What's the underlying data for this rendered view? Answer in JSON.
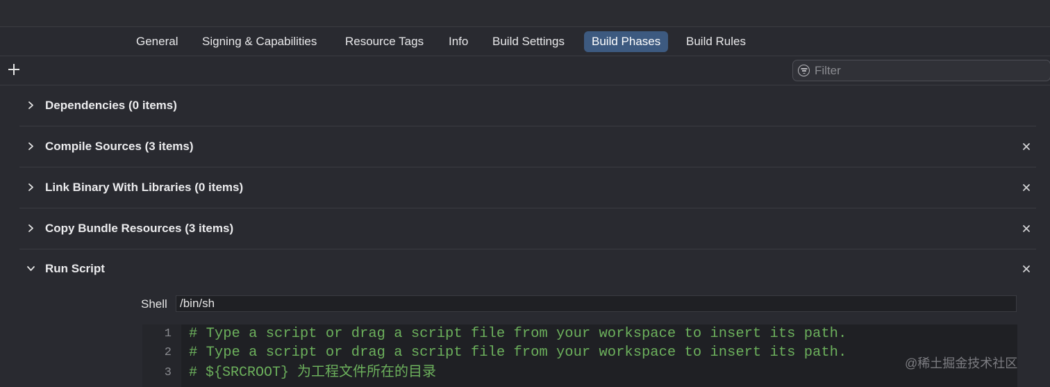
{
  "tabs": [
    {
      "label": "General",
      "active": false
    },
    {
      "label": "Signing & Capabilities",
      "active": false
    },
    {
      "label": "Resource Tags",
      "active": false
    },
    {
      "label": "Info",
      "active": false
    },
    {
      "label": "Build Settings",
      "active": false
    },
    {
      "label": "Build Phases",
      "active": true
    },
    {
      "label": "Build Rules",
      "active": false
    }
  ],
  "toolbar": {
    "add_icon": "plus-icon",
    "filter_placeholder": "Filter",
    "filter_icon": "filter-icon"
  },
  "phases": [
    {
      "title": "Dependencies (0 items)",
      "expanded": false,
      "removable": false
    },
    {
      "title": "Compile Sources (3 items)",
      "expanded": false,
      "removable": true
    },
    {
      "title": "Link Binary With Libraries (0 items)",
      "expanded": false,
      "removable": true
    },
    {
      "title": "Copy Bundle Resources (3 items)",
      "expanded": false,
      "removable": true
    },
    {
      "title": "Run Script",
      "expanded": true,
      "removable": true
    }
  ],
  "run_script": {
    "shell_label": "Shell",
    "shell_value": "/bin/sh",
    "lines": [
      {
        "number": "1",
        "code": "# Type a script or drag a script file from your workspace to insert its path."
      },
      {
        "number": "2",
        "code": "# Type a script or drag a script file from your workspace to insert its path."
      },
      {
        "number": "3",
        "code": "# ${SRCROOT} 为工程文件所在的目录"
      }
    ]
  },
  "watermark": "@稀土掘金技术社区",
  "colors": {
    "background": "#292a30",
    "active_tab": "#3d5a80",
    "comment_green": "#6cb05c",
    "editor_bg": "#1f2024"
  }
}
